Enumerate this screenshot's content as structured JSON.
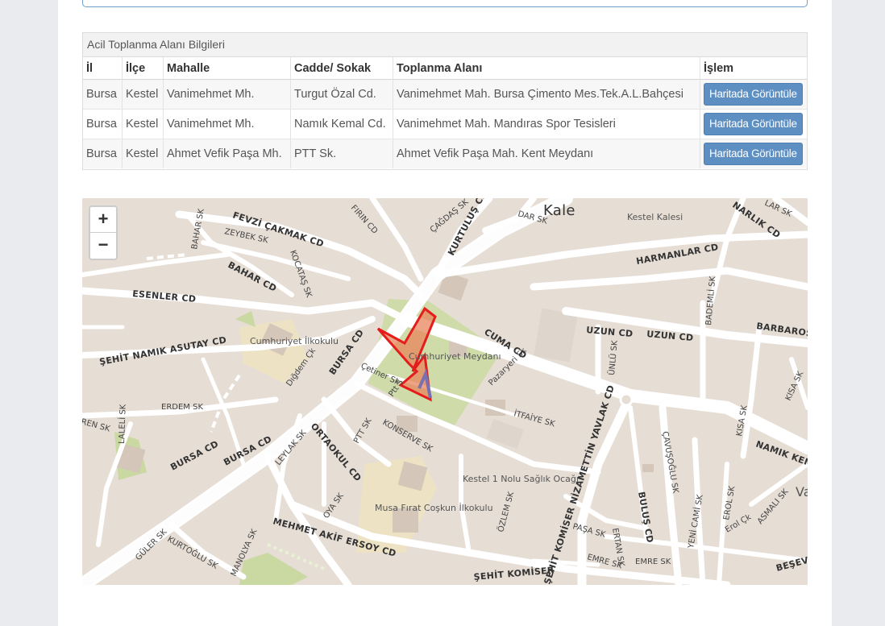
{
  "panel": {
    "title": "Acil Toplanma Alanı Bilgileri",
    "columns": [
      "İl",
      "İlçe",
      "Mahalle",
      "Cadde/ Sokak",
      "Toplanma Alanı",
      "İşlem"
    ],
    "rows": [
      {
        "il": "Bursa",
        "ilce": "Kestel",
        "mahalle": "Vanimehmet Mh.",
        "sokak": "Turgut Özal Cd.",
        "alan": "Vanimehmet Mah. Bursa Çimento Mes.Tek.A.L.Bahçesi",
        "action": "Haritada Görüntüle"
      },
      {
        "il": "Bursa",
        "ilce": "Kestel",
        "mahalle": "Vanimehmet Mh.",
        "sokak": "Namık Kemal Cd.",
        "alan": "Vanimehmet Mah. Mandıras Spor Tesisleri",
        "action": "Haritada Görüntüle"
      },
      {
        "il": "Bursa",
        "ilce": "Kestel",
        "mahalle": "Ahmet Vefik Paşa Mh.",
        "sokak": "PTT Sk.",
        "alan": "Ahmet Vefik Paşa Mah. Kent Meydanı",
        "action": "Haritada Görüntüle"
      }
    ]
  },
  "map": {
    "zoom_in": "+",
    "zoom_out": "−",
    "labels": {
      "kale": "Kale",
      "kestel_kalesi": "Kestel Kalesi",
      "fevzi": "FEVZİ ÇAKMAK CD",
      "zeybek": "ZEYBEK SK",
      "bahar_sk": "BAHAR SK",
      "bahar_cd": "BAHAR CD",
      "kocatas": "KOCATAŞ SK",
      "firin": "FIRIN CD",
      "cagdas": "ÇAĞDAŞ SK",
      "kurtulus": "KURTULUŞ CD",
      "dar": "DAR SK",
      "harmanlar": "HARMANLAR CD",
      "narlik": "NARLIK CD",
      "esenler": "ESENLER CD",
      "sehit_namik": "ŞEHİT NAMIK ASUTAY CD",
      "cumhuriyet_ilk": "Cumhuriyet İlkokulu",
      "dogdem": "Dığdem Çk",
      "erdem": "ERDEM SK",
      "laleli": "LALELİ SK",
      "bursa1": "BURSA CD",
      "bursa2": "BURSA CD",
      "bursa3": "BURSA CD",
      "cumhuriyet_meydani": "Cumhuriyet Meydanı",
      "cetiner": "Çetiner Sk",
      "pazaryeri": "Pazaryeri Sk",
      "cuma": "CUMA CD",
      "uzun1": "UZUN CD",
      "uzun2": "UZUN CD",
      "bademli": "BADEMLİ SK",
      "barbaros": "BARBAROS",
      "unlu": "ÜNLÜ SK",
      "itfaiye": "İTFAİYE SK",
      "kisa": "KISA SK",
      "kisa2": "KISA SK",
      "namik_kemal": "NAMIK KEM",
      "ortaokul": "ORTAOKUL CD",
      "ptt": "PTT SK",
      "konserve": "KONSERVE SK",
      "leylak": "LEYLAK SK",
      "oya": "OYA SK",
      "saglik": "Kestel 1 Nolu Sağlık Ocağı",
      "musa": "Musa Fırat Coşkun İlkokulu",
      "ozlem": "ÖZLEM SK",
      "nizamettin": "ŞEHİT KOMİSER NİZAMETTİN YAVLAK CD",
      "ertan": "ERTAN SK",
      "bulus": "BULUŞ CD",
      "cavusoglu": "ÇAVUŞOĞLU SK",
      "yeni_cami": "YENİ CAMİ SK",
      "erol": "EROL SK",
      "erol_ck": "Erol Çk",
      "asmali": "ASMALI SK",
      "pasa": "PAŞA SK",
      "emre1": "EMRE SK",
      "emre2": "EMRE SK",
      "mehmet_akif": "MEHMET AKİF ERSOY CD",
      "manolya": "MANOLYA SK",
      "guler": "GÜLER SK",
      "kurtoglu": "KURTOĞLU SK",
      "sehit_komiser": "ŞEHİT KOMİSER",
      "besev": "BEŞEV",
      "ptt_s": "Ptt S",
      "ren": "REN SK",
      "lar": "LAR SK",
      "va": "Va"
    }
  }
}
